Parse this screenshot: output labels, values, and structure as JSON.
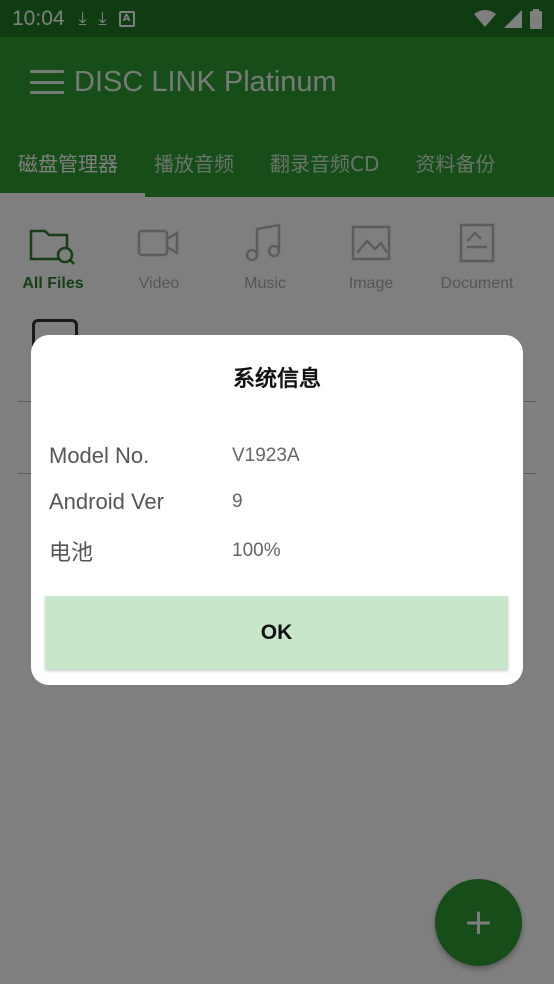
{
  "status_bar": {
    "time": "10:04",
    "badge_letter": "A"
  },
  "app_bar": {
    "title": "DISC LINK Platinum"
  },
  "tabs": [
    {
      "label": "磁盘管理器",
      "active": true
    },
    {
      "label": "播放音频",
      "active": false
    },
    {
      "label": "翻录音频CD",
      "active": false
    },
    {
      "label": "资料备份",
      "active": false
    }
  ],
  "categories": [
    {
      "label": "All Files",
      "icon": "folder-search-icon",
      "active": true
    },
    {
      "label": "Video",
      "icon": "video-camera-icon",
      "active": false
    },
    {
      "label": "Music",
      "icon": "music-note-icon",
      "active": false
    },
    {
      "label": "Image",
      "icon": "image-icon",
      "active": false
    },
    {
      "label": "Document",
      "icon": "document-icon",
      "active": false
    }
  ],
  "fab": {
    "label": "+"
  },
  "dialog": {
    "title": "系统信息",
    "rows": [
      {
        "key": "Model No.",
        "value": "V1923A"
      },
      {
        "key": "Android Ver",
        "value": "9"
      },
      {
        "key": "电池",
        "value": "100%"
      }
    ],
    "ok_label": "OK"
  },
  "colors": {
    "status_bar": "#1f7a22",
    "app_bar": "#2e9a33",
    "ok_button": "#c8e6c9",
    "active_category": "#2e7d32"
  }
}
